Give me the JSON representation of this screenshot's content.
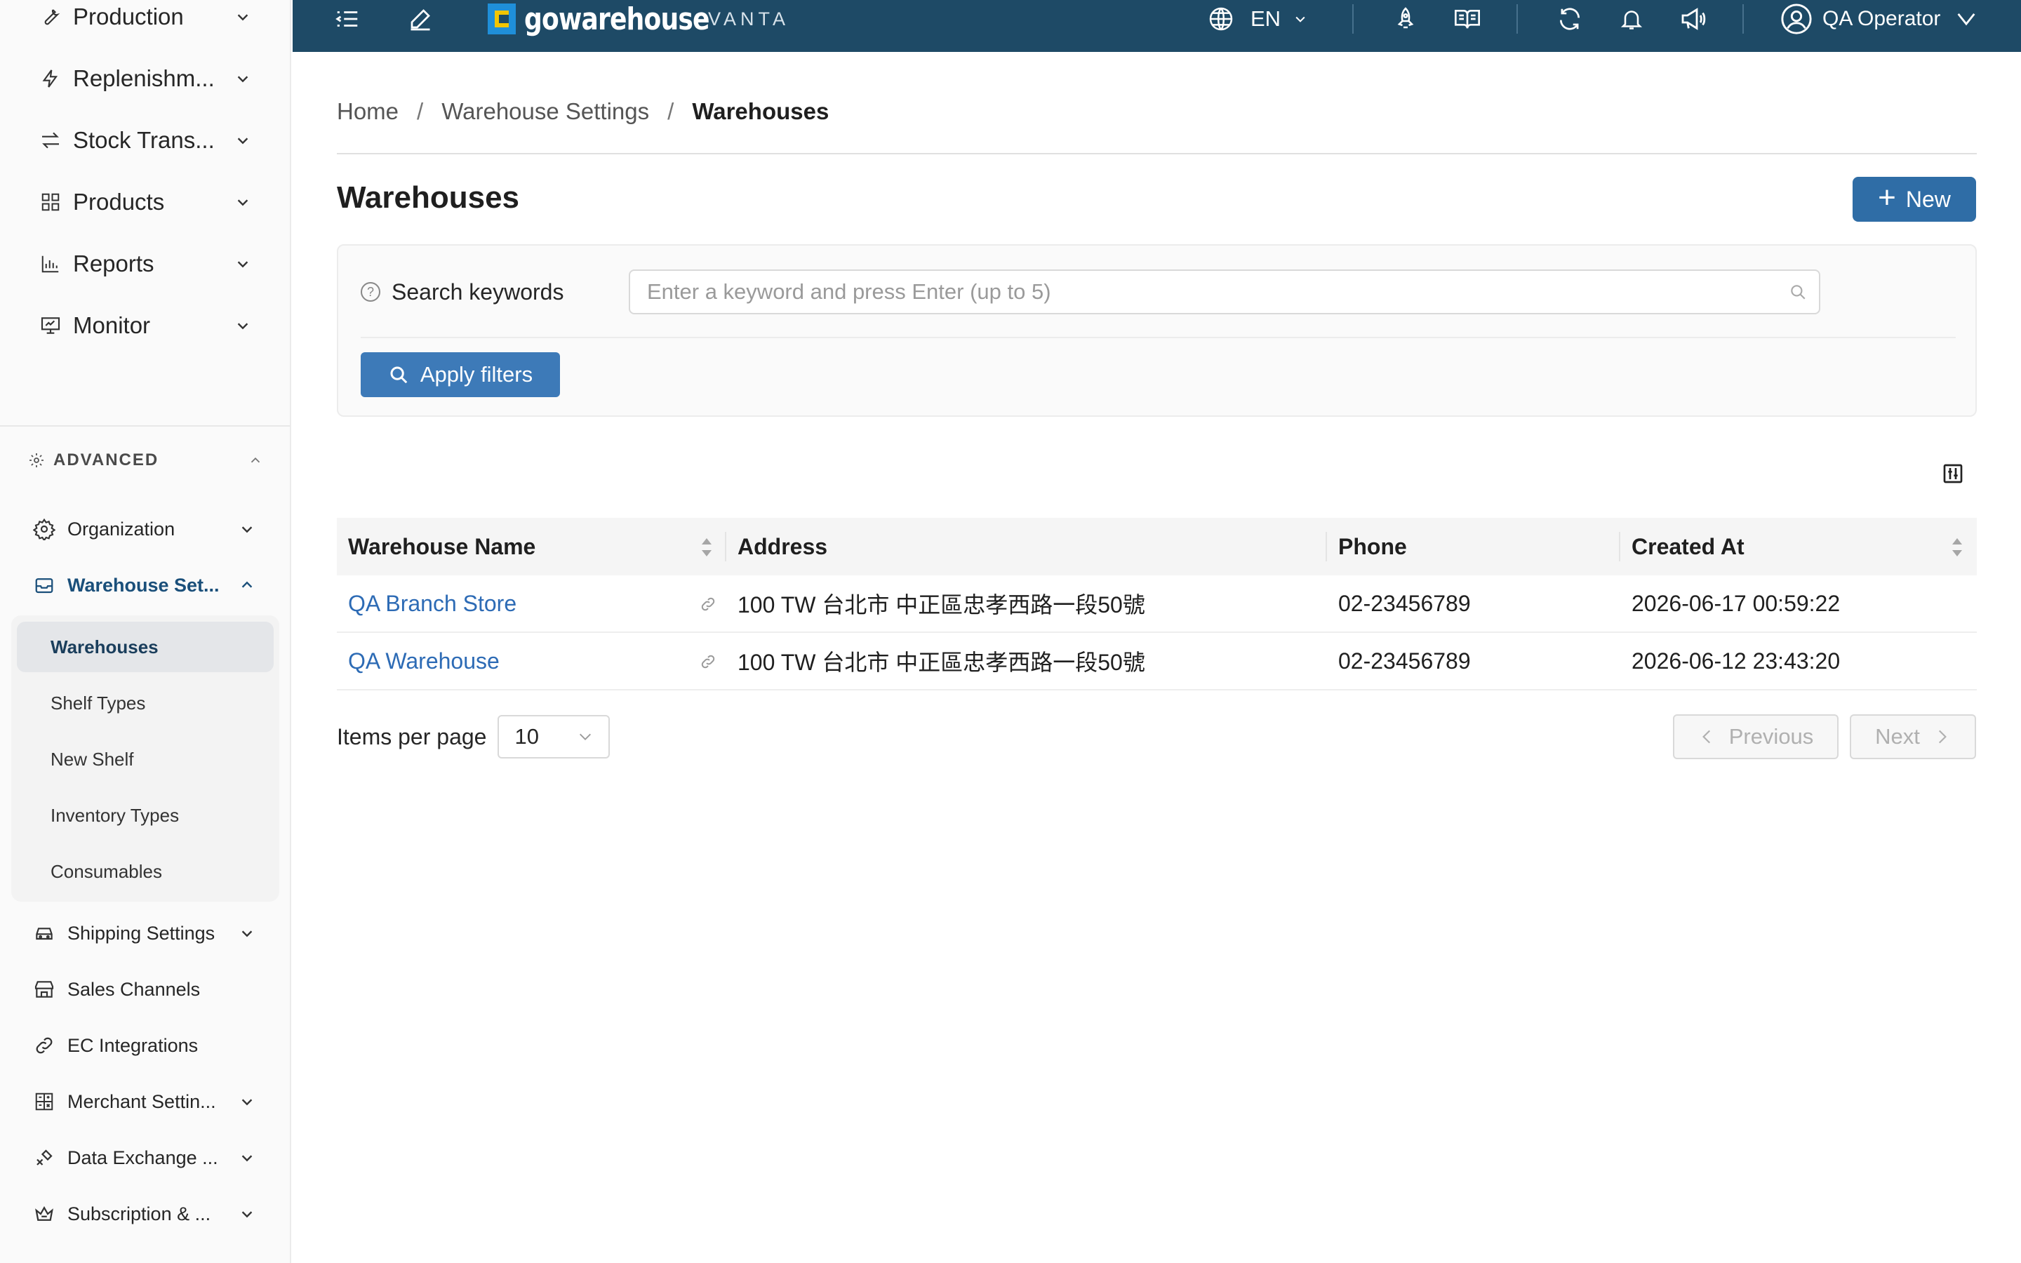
{
  "sidebar": {
    "top_items": [
      {
        "label": "Production",
        "icon": "wrench-icon"
      },
      {
        "label": "Replenishm...",
        "icon": "bolt-icon"
      },
      {
        "label": "Stock Trans...",
        "icon": "transfer-icon"
      },
      {
        "label": "Products",
        "icon": "grid-icon"
      },
      {
        "label": "Reports",
        "icon": "bar-chart-icon"
      },
      {
        "label": "Monitor",
        "icon": "monitor-icon"
      }
    ],
    "advanced_label": "ADVANCED",
    "advanced_items": [
      {
        "label": "Organization",
        "icon": "gear-icon"
      },
      {
        "label": "Warehouse Set...",
        "icon": "inbox-icon"
      }
    ],
    "warehouse_sub_items": [
      {
        "label": "Warehouses"
      },
      {
        "label": "Shelf Types"
      },
      {
        "label": "New Shelf"
      },
      {
        "label": "Inventory Types"
      },
      {
        "label": "Consumables"
      }
    ],
    "lower_items": [
      {
        "label": "Shipping Settings",
        "icon": "car-icon"
      },
      {
        "label": "Sales Channels",
        "icon": "shop-icon"
      },
      {
        "label": "EC Integrations",
        "icon": "link-icon"
      },
      {
        "label": "Merchant Settin...",
        "icon": "calculator-icon"
      },
      {
        "label": "Data Exchange ...",
        "icon": "api-icon"
      },
      {
        "label": "Subscription & ...",
        "icon": "crown-icon"
      }
    ]
  },
  "topbar": {
    "logo_text": "gowarehouse",
    "logo_sub": "VANTA",
    "language": "EN",
    "user_name": "QA Operator"
  },
  "breadcrumb": {
    "home": "Home",
    "section": "Warehouse Settings",
    "current": "Warehouses"
  },
  "page": {
    "title": "Warehouses",
    "new_button": "New"
  },
  "filters": {
    "label": "Search keywords",
    "placeholder": "Enter a keyword and press Enter (up to 5)",
    "apply_button": "Apply filters"
  },
  "table": {
    "headers": {
      "name": "Warehouse Name",
      "address": "Address",
      "phone": "Phone",
      "created": "Created At"
    },
    "rows": [
      {
        "name": "QA Branch Store",
        "address": "100 TW 台北市 中正區忠孝西路一段50號",
        "phone": "02-23456789",
        "created": "2026-06-17 00:59:22"
      },
      {
        "name": "QA Warehouse",
        "address": "100 TW 台北市 中正區忠孝西路一段50號",
        "phone": "02-23456789",
        "created": "2026-06-12 23:43:20"
      }
    ]
  },
  "pagination": {
    "items_per_page_label": "Items per page",
    "page_size": "10",
    "previous": "Previous",
    "next": "Next"
  },
  "colors": {
    "topbar": "#1e4a66",
    "primary": "#2f6da6",
    "link": "#2d6bb5"
  }
}
